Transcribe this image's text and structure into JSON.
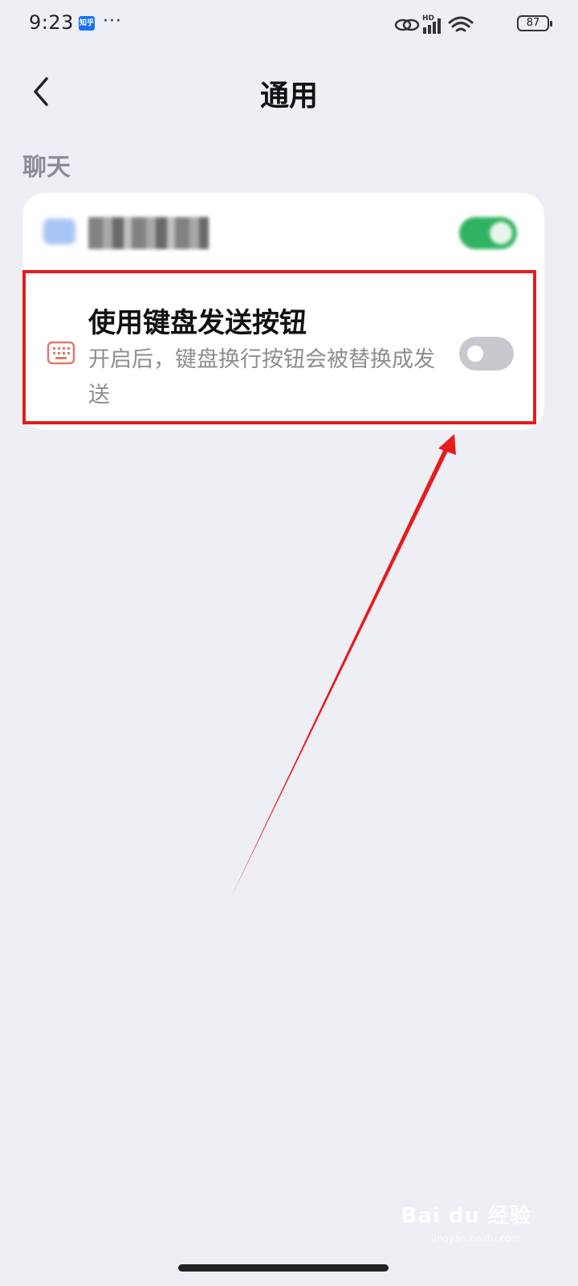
{
  "status_bar": {
    "time": "9:23",
    "app_badge": "知乎",
    "more": "···",
    "battery": "87",
    "signal_label": "HD"
  },
  "header": {
    "title": "通用",
    "back_icon": "chevron-left-icon"
  },
  "section": {
    "title": "聊天"
  },
  "settings": {
    "item1": {
      "toggle_on": true,
      "toggle_color": "#2fb360"
    },
    "item2": {
      "title": "使用键盘发送按钮",
      "description": "开启后，键盘换行按钮会被替换成发送",
      "icon": "keyboard-icon",
      "toggle_on": false
    }
  },
  "annotation": {
    "highlight_color": "#e51c1c"
  },
  "watermark": {
    "brand": "Bai du 经验",
    "url": "jingyan.baidu.com"
  }
}
